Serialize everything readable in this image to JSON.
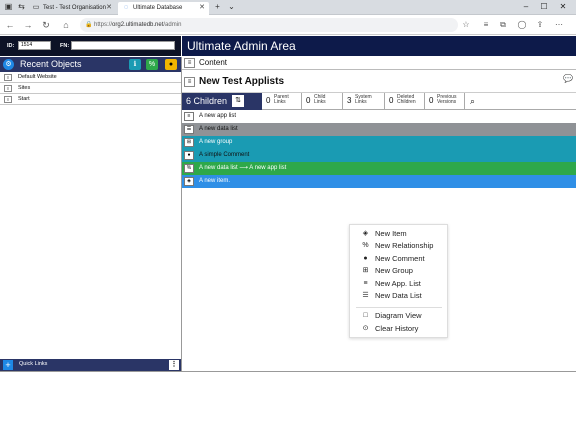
{
  "browser": {
    "tabs": [
      {
        "title": "Test - Test Organisation",
        "icon": "page-icon"
      },
      {
        "title": "Ultimate Database",
        "icon": "loading-icon"
      }
    ],
    "url_prefix": "https://",
    "url_host": "org2.ultimatedb.net",
    "url_path": "/admin",
    "new_tab": "+"
  },
  "left": {
    "id_label": "ID:",
    "id_value": "1514",
    "fn_label": "FN:",
    "fn_value": "",
    "recent_title": "Recent Objects",
    "recent_items": [
      "Default Website",
      "Sites",
      "Start"
    ],
    "quick_links": "Quick Links"
  },
  "main": {
    "header": "Ultimate Admin Area",
    "content_label": "Content",
    "title": "New Test Applists",
    "children_count": "6 Children",
    "counters": [
      {
        "value": "0",
        "label": "Parent Links"
      },
      {
        "value": "0",
        "label": "Child Links"
      },
      {
        "value": "3",
        "label": "System Links"
      },
      {
        "value": "0",
        "label": "Deleted Children"
      },
      {
        "value": "0",
        "label": "Previous Versions"
      }
    ],
    "rows": [
      {
        "label": "A new app list",
        "icon": "list-icon",
        "bg": "#ffffff",
        "fg": "#111111"
      },
      {
        "label": "A new data list",
        "icon": "database-icon",
        "bg": "#8f9296",
        "fg": "#111111"
      },
      {
        "label": "A new group",
        "icon": "group-icon",
        "bg": "#1a9bb3",
        "fg": "#ffffff"
      },
      {
        "label": "A simple Comment",
        "icon": "comment-icon",
        "bg": "#1a9bb3",
        "fg": "#111111"
      },
      {
        "label": "A new data list ⟶ A new app list",
        "icon": "link-icon",
        "bg": "#2ea84a",
        "fg": "#ffffff"
      },
      {
        "label": "A new item.",
        "icon": "cube-icon",
        "bg": "#2f8fe6",
        "fg": "#ffffff"
      }
    ]
  },
  "context_menu": {
    "items": [
      {
        "label": "New Item",
        "icon": "cube-icon"
      },
      {
        "label": "New Relationship",
        "icon": "link-icon"
      },
      {
        "label": "New Comment",
        "icon": "comment-icon"
      },
      {
        "label": "New Group",
        "icon": "group-icon"
      },
      {
        "label": "New App. List",
        "icon": "list-icon"
      },
      {
        "label": "New Data List",
        "icon": "database-icon"
      },
      {
        "label": "Diagram View",
        "icon": "square-icon"
      },
      {
        "label": "Clear History",
        "icon": "history-icon"
      }
    ]
  },
  "colors": {
    "header_dark": "#0d1a4a",
    "panel_blue": "#2a3566",
    "info_teal": "#1a9bb3",
    "link_green": "#2ea84a",
    "warn_yellow": "#f0b400",
    "accent_blue": "#1e88e5"
  }
}
